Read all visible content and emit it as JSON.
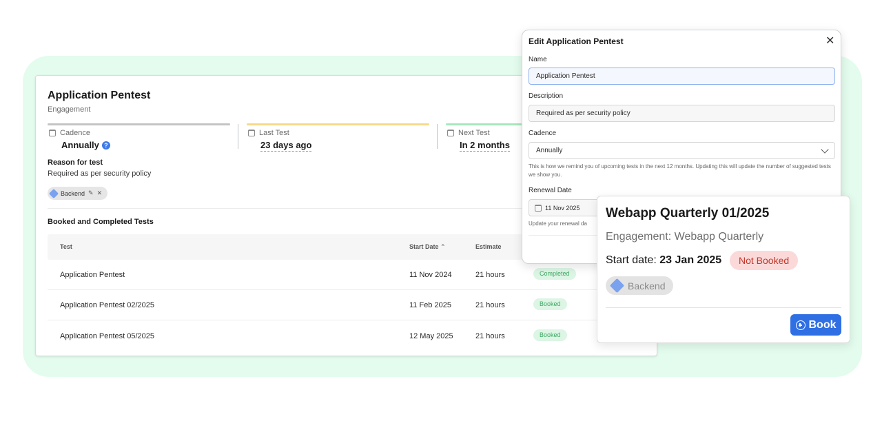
{
  "engagement": {
    "title": "Application Pentest",
    "subtitle": "Engagement",
    "stats": [
      {
        "label": "Cadence",
        "value": "Annually",
        "bar_color": "#c4c4c4"
      },
      {
        "label": "Last Test",
        "value": "23 days ago",
        "bar_color": "#f7d98a"
      },
      {
        "label": "Next Test",
        "value": "In 2 months",
        "bar_color": "#a8e6bd"
      }
    ],
    "help_icon": "?",
    "reason_title": "Reason for test",
    "reason_text": "Required as per security policy",
    "tag": {
      "label": "Backend",
      "edit_icon": "✎",
      "remove_icon": "✕"
    },
    "tests_title": "Booked and Completed Tests",
    "columns": {
      "test": "Test",
      "start_date": "Start Date",
      "estimate": "Estimate",
      "sort_icon": "⌃"
    },
    "rows": [
      {
        "test": "Application Pentest",
        "start_date": "11 Nov 2024",
        "estimate": "21 hours",
        "status": "Completed"
      },
      {
        "test": "Application Pentest 02/2025",
        "start_date": "11 Feb 2025",
        "estimate": "21 hours",
        "status": "Booked"
      },
      {
        "test": "Application Pentest 05/2025",
        "start_date": "12 May 2025",
        "estimate": "21 hours",
        "status": "Booked"
      }
    ]
  },
  "edit_modal": {
    "title": "Edit Application Pentest",
    "close_icon": "✕",
    "name_label": "Name",
    "name_value": "Application Pentest",
    "description_label": "Description",
    "description_value": "Required as per security policy",
    "cadence_label": "Cadence",
    "cadence_value": "Annually",
    "cadence_hint": "This is how we remind you of upcoming tests in the next 12 months. Updating this will update the number of suggested tests we show you.",
    "renewal_label": "Renewal Date",
    "renewal_value": "11 Nov 2025",
    "renewal_hint": "Update your renewal da"
  },
  "popover": {
    "title": "Webapp Quarterly 01/2025",
    "engagement": "Engagement: Webapp Quarterly",
    "start_prefix": "Start date:",
    "start_value": "23 Jan 2025",
    "status": "Not Booked",
    "tag": "Backend",
    "book_label": "Book"
  },
  "colors": {
    "accent": "#2f6fe4",
    "success": "#3fa863",
    "danger": "#c0392b",
    "background": "#e3fcee"
  }
}
